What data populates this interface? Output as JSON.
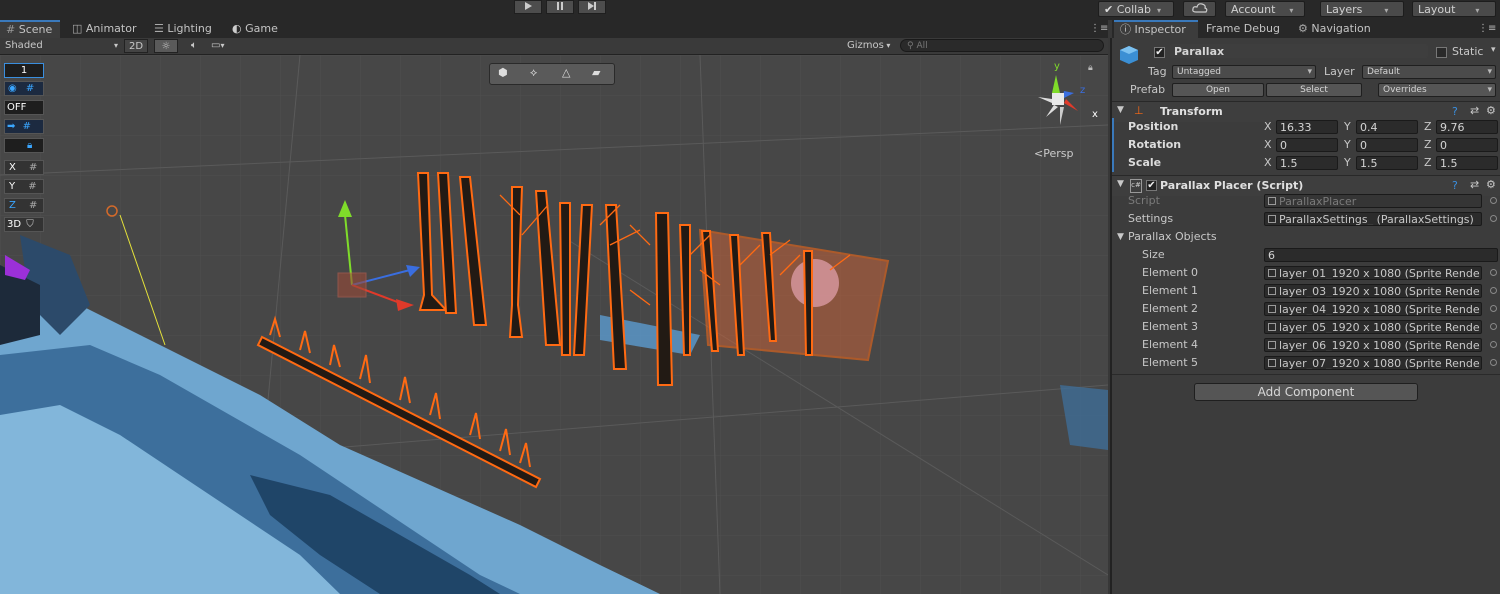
{
  "toolbar": {
    "play_icon": "play-icon",
    "pause_icon": "pause-icon",
    "step_icon": "step-icon",
    "collab": "Collab",
    "account": "Account",
    "layers": "Layers",
    "layout": "Layout"
  },
  "scene_tabs": [
    {
      "label": "Scene",
      "icon": "grid-icon"
    },
    {
      "label": "Animator",
      "icon": "animator-icon"
    },
    {
      "label": "Lighting",
      "icon": "lighting-icon"
    },
    {
      "label": "Game",
      "icon": "game-icon"
    }
  ],
  "scene_toolbar": {
    "shading": "Shaded",
    "mode_2d": "2D",
    "gizmos": "Gizmos",
    "search_placeholder": "All"
  },
  "scene_overlay": {
    "count": "1",
    "off": "OFF",
    "x": "X",
    "y": "Y",
    "z": "Z",
    "three_d": "3D",
    "persp": "Persp",
    "gizmo_y": "y",
    "gizmo_z": "z",
    "gizmo_x": "x"
  },
  "inspector_tabs": [
    {
      "label": "Inspector",
      "icon": "info-icon"
    },
    {
      "label": "Frame Debug"
    },
    {
      "label": "Navigation",
      "icon": "navigation-icon"
    }
  ],
  "gameobject": {
    "name": "Parallax",
    "static_label": "Static",
    "tag_label": "Tag",
    "tag_value": "Untagged",
    "layer_label": "Layer",
    "layer_value": "Default",
    "prefab_label": "Prefab",
    "open": "Open",
    "select": "Select",
    "overrides": "Overrides"
  },
  "transform": {
    "title": "Transform",
    "position_label": "Position",
    "rotation_label": "Rotation",
    "scale_label": "Scale",
    "position": {
      "x": "16.33",
      "y": "0.4",
      "z": "9.76"
    },
    "rotation": {
      "x": "0",
      "y": "0",
      "z": "0"
    },
    "scale": {
      "x": "1.5",
      "y": "1.5",
      "z": "1.5"
    }
  },
  "parallax_placer": {
    "title": "Parallax Placer (Script)",
    "script_label": "Script",
    "script_value": "ParallaxPlacer",
    "settings_label": "Settings",
    "settings_value": "ParallaxSettings_ (ParallaxSettings)",
    "objects_label": "Parallax Objects",
    "size_label": "Size",
    "size_value": "6",
    "elements": [
      {
        "label": "Element 0",
        "value": "layer_01_1920 x 1080 (Sprite Rende"
      },
      {
        "label": "Element 1",
        "value": "layer_03_1920 x 1080 (Sprite Rende"
      },
      {
        "label": "Element 2",
        "value": "layer_04_1920 x 1080 (Sprite Rende"
      },
      {
        "label": "Element 3",
        "value": "layer_05_1920 x 1080 (Sprite Rende"
      },
      {
        "label": "Element 4",
        "value": "layer_06_1920 x 1080 (Sprite Rende"
      },
      {
        "label": "Element 5",
        "value": "layer_07_1920 x 1080 (Sprite Rende"
      }
    ]
  },
  "add_component": "Add Component",
  "colors": {
    "selection_orange": "#ff6a13",
    "accent_blue": "#3a79bb",
    "terrain_blue": "#5f9bc8"
  }
}
